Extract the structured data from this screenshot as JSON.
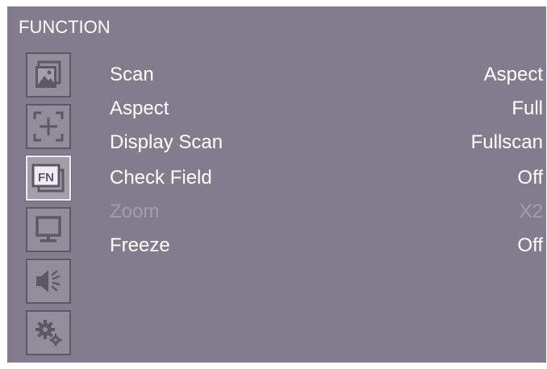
{
  "window": {
    "title": "FUNCTION"
  },
  "sidebar": {
    "items": [
      {
        "icon": "picture-icon",
        "active": false
      },
      {
        "icon": "marker-icon",
        "active": false
      },
      {
        "icon": "function-icon",
        "label": "FN",
        "active": true
      },
      {
        "icon": "display-icon",
        "active": false
      },
      {
        "icon": "audio-icon",
        "active": false
      },
      {
        "icon": "settings-icon",
        "active": false
      }
    ]
  },
  "menu": {
    "items": [
      {
        "label": "Scan",
        "value": "Aspect",
        "enabled": true
      },
      {
        "label": "Aspect",
        "value": "Full",
        "enabled": true
      },
      {
        "label": "Display Scan",
        "value": "Fullscan",
        "enabled": true
      },
      {
        "label": "Check Field",
        "value": "Off",
        "enabled": true
      },
      {
        "label": "Zoom",
        "value": "X2",
        "enabled": false
      },
      {
        "label": "Freeze",
        "value": "Off",
        "enabled": true
      }
    ]
  },
  "colors": {
    "panel": "#837c8c",
    "text": "#ffffff",
    "disabled_text": "#a39dab",
    "icon_border": "#5e5866",
    "active_border": "#efedf2"
  }
}
